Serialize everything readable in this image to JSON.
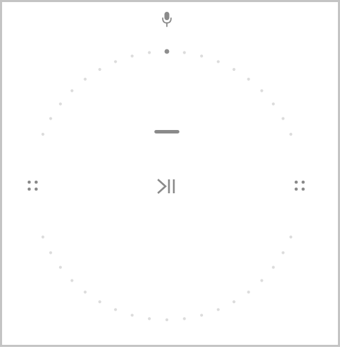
{
  "controls": {
    "microphone_icon": "microphone-icon",
    "volume_down_icon": "minus-icon",
    "play_pause_icon": "play-pause-icon",
    "left_button_icon": "four-dots-icon",
    "right_button_icon": "four-dots-icon"
  },
  "volume_ring": {
    "dot_count": 48,
    "visible_level": 0.0
  },
  "colors": {
    "icon": "#8a8a8a",
    "ring_dot": "#dcdcdc",
    "ring_indicator": "#8e8e8e",
    "frame_border": "#c4c4c4",
    "background": "#ffffff"
  }
}
